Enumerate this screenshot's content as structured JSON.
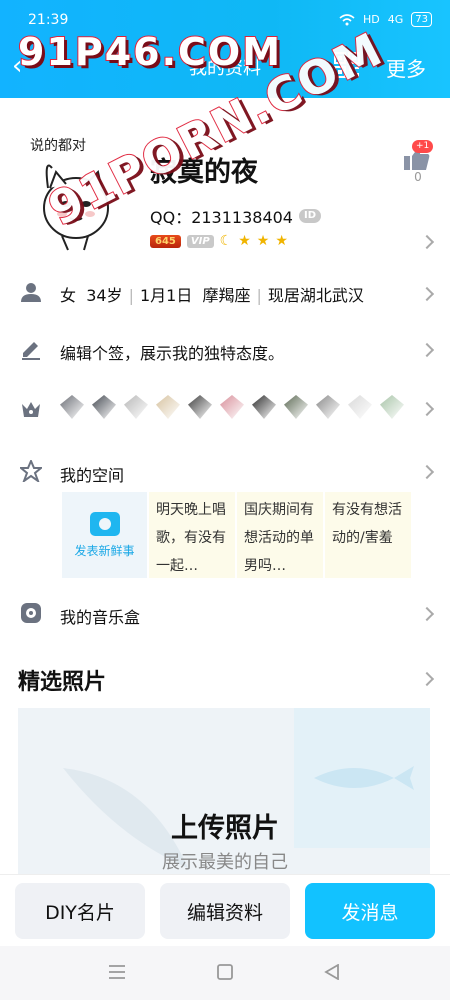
{
  "status_bar": {
    "time": "21:39",
    "network": "HD",
    "signal": "4G",
    "battery": "73"
  },
  "nav_bar": {
    "title": "我的资料",
    "more_label": "更多",
    "watermark": "91P46.COM"
  },
  "profile": {
    "avatar_caption": "说的都对",
    "nickname": "寂寞的夜",
    "qq_line": "QQ：2131138404",
    "id_badge": "ID",
    "level": "645",
    "vip": "VIP",
    "likes_count": "0",
    "likes_new": "+1",
    "watermark": "91PORN.COM"
  },
  "info_row": {
    "gender": "女",
    "age": "34岁",
    "birthday": "1月1日",
    "zodiac": "摩羯座",
    "location": "现居湖北武汉"
  },
  "signature_row": {
    "text": "编辑个签，展示我的独特态度。"
  },
  "medals": [
    {
      "name": "medal-1",
      "color": "#6c6f76"
    },
    {
      "name": "medal-2",
      "color": "#454a52"
    },
    {
      "name": "medal-3",
      "color": "#b8b8b8"
    },
    {
      "name": "medal-4",
      "color": "#d7c3a0"
    },
    {
      "name": "medal-5",
      "color": "#3f3f3f"
    },
    {
      "name": "medal-6",
      "color": "#d88f9a"
    },
    {
      "name": "medal-7",
      "color": "#2d2d2d"
    },
    {
      "name": "medal-8",
      "color": "#5d6a55"
    },
    {
      "name": "medal-9",
      "color": "#8a8a8a"
    },
    {
      "name": "medal-10",
      "color": "#d9d9d9"
    },
    {
      "name": "medal-11",
      "color": "#a8c4a8"
    }
  ],
  "space_row": {
    "label": "我的空间",
    "post_label": "发表新鲜事",
    "posts": [
      "明天晚上唱歌，有没有一起…",
      "国庆期间有想活动的单男吗…",
      "有没有想活动的/害羞"
    ]
  },
  "music_row": {
    "label": "我的音乐盒"
  },
  "photos_section": {
    "title": "精选照片",
    "upload_title": "上传照片",
    "upload_subtitle": "展示最美的自己"
  },
  "actions": {
    "diy_label": "DIY名片",
    "edit_label": "编辑资料",
    "message_label": "发消息"
  },
  "colors": {
    "accent": "#12c2ff",
    "header": "#12b3ff"
  }
}
